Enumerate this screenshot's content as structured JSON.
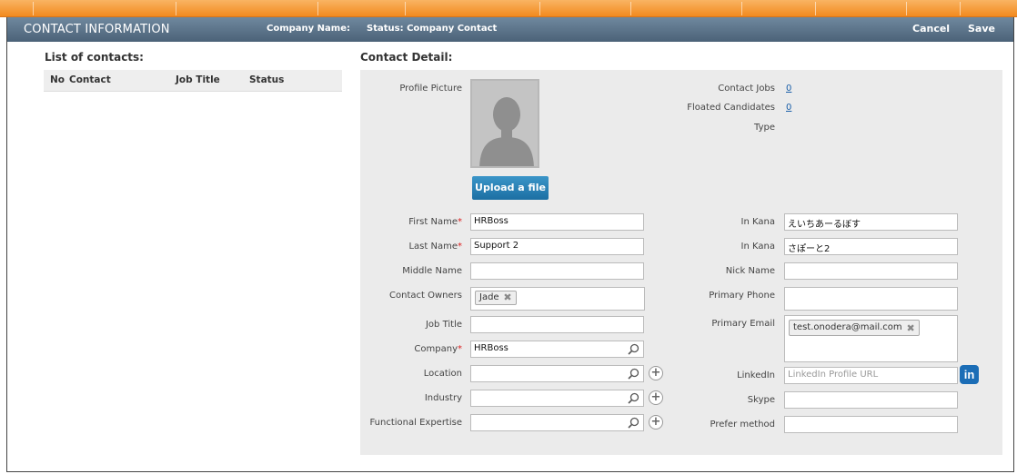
{
  "header": {
    "title": "CONTACT INFORMATION",
    "company_name_label": "Company Name:",
    "status_label": "Status: Company Contact",
    "cancel": "Cancel",
    "save": "Save"
  },
  "contacts_list": {
    "title": "List of contacts:",
    "columns": [
      "No",
      "Contact",
      "Job Title",
      "Status"
    ]
  },
  "detail": {
    "title": "Contact Detail:",
    "profile_picture_label": "Profile Picture",
    "upload_label": "Upload a file",
    "contact_jobs_label": "Contact Jobs",
    "contact_jobs_value": "0",
    "floated_candidates_label": "Floated Candidates",
    "floated_candidates_value": "0",
    "type_label": "Type",
    "left_fields": {
      "first_name": {
        "label": "First Name",
        "value": "HRBoss",
        "required": true
      },
      "last_name": {
        "label": "Last Name",
        "value": "Support 2",
        "required": true
      },
      "middle_name": {
        "label": "Middle Name",
        "value": ""
      },
      "contact_owners": {
        "label": "Contact Owners",
        "tags": [
          "Jade"
        ]
      },
      "job_title": {
        "label": "Job Title",
        "value": ""
      },
      "company": {
        "label": "Company",
        "value": "HRBoss",
        "required": true
      },
      "location": {
        "label": "Location",
        "value": ""
      },
      "industry": {
        "label": "Industry",
        "value": ""
      },
      "functional_expertise": {
        "label": "Functional Expertise",
        "value": ""
      }
    },
    "right_fields": {
      "in_kana_1": {
        "label": "In Kana",
        "value": "えいちあーるぼす"
      },
      "in_kana_2": {
        "label": "In Kana",
        "value": "さぽーと2"
      },
      "nick_name": {
        "label": "Nick Name",
        "value": ""
      },
      "primary_phone": {
        "label": "Primary Phone",
        "value": ""
      },
      "primary_email": {
        "label": "Primary Email",
        "tags": [
          "test.onodera@mail.com"
        ]
      },
      "linkedin": {
        "label": "LinkedIn",
        "placeholder": "LinkedIn Profile URL",
        "icon_text": "in"
      },
      "skype": {
        "label": "Skype",
        "value": ""
      },
      "prefer_method": {
        "label": "Prefer method",
        "value": ""
      }
    },
    "required_mark": "*",
    "tag_remove": "✖",
    "plus_glyph": "+"
  },
  "colors": {
    "header_bg": "#56708a",
    "topbar": "#f28a1e",
    "upload_btn": "#2a84bb",
    "linkedin": "#1b6db6",
    "panel_bg": "#ebebeb"
  }
}
